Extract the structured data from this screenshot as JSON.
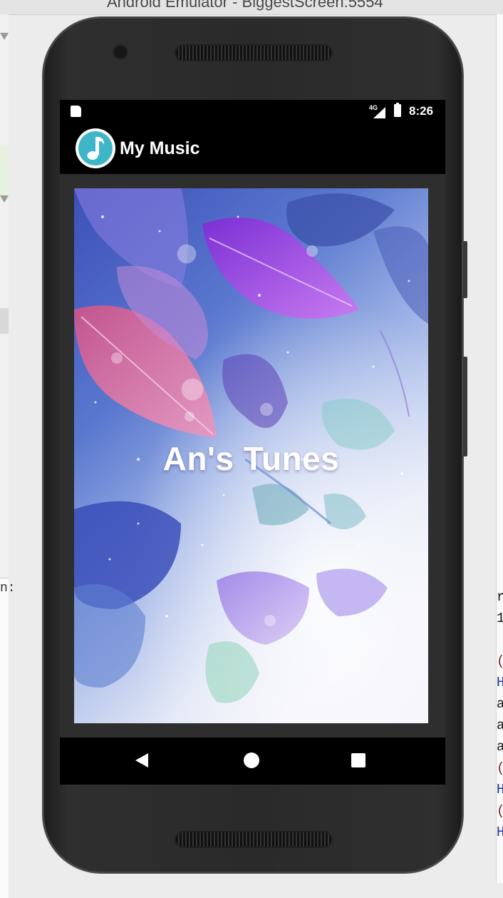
{
  "window": {
    "title": "Android Emulator - BiggestScreen:5554"
  },
  "status_bar": {
    "time": "8:26",
    "network": "4G"
  },
  "app_bar": {
    "title": "My Music",
    "icon": "music-note-icon"
  },
  "splash": {
    "title": "An's Tunes"
  },
  "nav_bar": {
    "back": "back-icon",
    "home": "home-icon",
    "recents": "recents-icon"
  },
  "ide_fragments": {
    "left_text": "n:",
    "right_lines": [
      "r",
      "1",
      "(",
      "H",
      "a",
      "a",
      "a",
      "(",
      "H",
      "(",
      "H"
    ],
    "right_colors": [
      "#111111",
      "#111111",
      "#8b1a1a",
      "#1c2f8f",
      "#111111",
      "#111111",
      "#111111",
      "#8b1a1a",
      "#1c2f8f",
      "#8b1a1a",
      "#1c2f8f"
    ]
  },
  "colors": {
    "accent": "#3fb6c8",
    "status_bar_bg": "#000000",
    "screen_frame": "#2e2e2e"
  }
}
